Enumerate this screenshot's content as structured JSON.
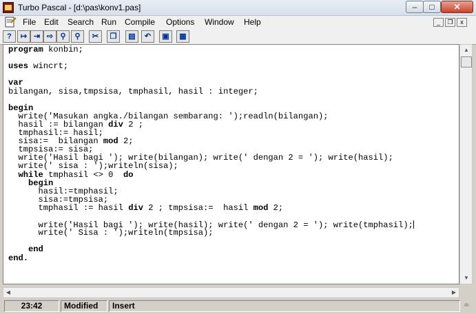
{
  "window": {
    "title": "Turbo Pascal - [d:\\pas\\konv1.pas]"
  },
  "menu": [
    "File",
    "Edit",
    "Search",
    "Run",
    "Compile",
    "Options",
    "Window",
    "Help"
  ],
  "toolbar": {
    "help_label": "?"
  },
  "code": {
    "lines": [
      [
        {
          "t": "program",
          "k": true
        },
        {
          "t": " konbin;"
        }
      ],
      [],
      [
        {
          "t": "uses",
          "k": true
        },
        {
          "t": " wincrt;"
        }
      ],
      [],
      [
        {
          "t": "var",
          "k": true
        }
      ],
      [
        {
          "t": "bilangan, sisa,tmpsisa, tmphasil, hasil : integer;"
        }
      ],
      [],
      [
        {
          "t": "begin",
          "k": true
        }
      ],
      [
        {
          "t": "  write('Masukan angka./bilangan sembarang: ');readln(bilangan);"
        }
      ],
      [
        {
          "t": "  hasil := bilangan "
        },
        {
          "t": "div",
          "k": true
        },
        {
          "t": " 2 ;"
        }
      ],
      [
        {
          "t": "  tmphasil:= hasil;"
        }
      ],
      [
        {
          "t": "  sisa:=  bilangan "
        },
        {
          "t": "mod",
          "k": true
        },
        {
          "t": " 2;"
        }
      ],
      [
        {
          "t": "  tmpsisa:= sisa;"
        }
      ],
      [
        {
          "t": "  write('Hasil bagi '); write(bilangan); write(' dengan 2 = '); write(hasil);"
        }
      ],
      [
        {
          "t": "  write(' sisa : ');writeln(sisa);"
        }
      ],
      [
        {
          "t": "  "
        },
        {
          "t": "while",
          "k": true
        },
        {
          "t": " tmphasil <> 0  "
        },
        {
          "t": "do",
          "k": true
        }
      ],
      [
        {
          "t": "    "
        },
        {
          "t": "begin",
          "k": true
        }
      ],
      [
        {
          "t": "      hasil:=tmphasil;"
        }
      ],
      [
        {
          "t": "      sisa:=tmpsisa;"
        }
      ],
      [
        {
          "t": "      tmphasil := hasil "
        },
        {
          "t": "div",
          "k": true
        },
        {
          "t": " 2 ; tmpsisa:=  hasil "
        },
        {
          "t": "mod",
          "k": true
        },
        {
          "t": " 2;"
        }
      ],
      [],
      [
        {
          "t": "      write('Hasil bagi '); write(hasil); write(' dengan 2 = '); write(tmphasil);"
        }
      ],
      [
        {
          "t": "      write(' Sisa : ');writeln(tmpsisa);"
        }
      ],
      [],
      [
        {
          "t": "    "
        },
        {
          "t": "end",
          "k": true
        }
      ],
      [
        {
          "t": "end.",
          "k": true
        }
      ]
    ],
    "cursor_line": 22
  },
  "status": {
    "position": "23:42",
    "modified": "Modified",
    "mode": "Insert"
  }
}
